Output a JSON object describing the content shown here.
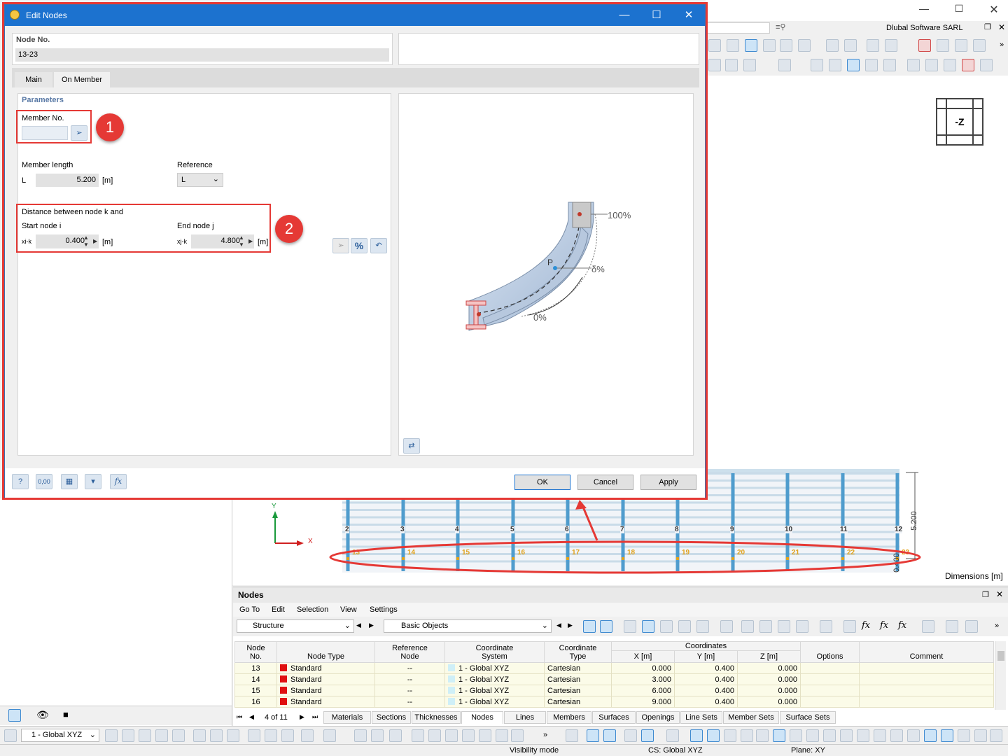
{
  "app": {
    "company": "Dlubal Software SARL",
    "dimensions_label": "Dimensions [m]",
    "view_cube_label": "-Z",
    "axis_x": "X",
    "axis_y": "Y",
    "dim_5200": "5.200",
    "dim_0400": "0.400"
  },
  "dialog": {
    "title": "Edit Nodes",
    "node_no_label": "Node No.",
    "node_no_value": "13-23",
    "tabs": [
      "Main",
      "On Member"
    ],
    "parameters_label": "Parameters",
    "member_no_label": "Member No.",
    "member_no_value": "",
    "member_length_label": "Member length",
    "length_symbol": "L",
    "length_value": "5.200",
    "unit_m": "[m]",
    "reference_label": "Reference",
    "reference_value": "L",
    "distance_label": "Distance between node k and",
    "start_node_label": "Start node i",
    "end_node_label": "End node j",
    "x_ik_symbol": "xi-k",
    "x_ik_value": "0.400",
    "x_jk_symbol": "xj-k",
    "x_jk_value": "4.800",
    "percent_btn": "%",
    "callout_1": "1",
    "callout_2": "2",
    "diagram": {
      "top": "100%",
      "mid": "δ%",
      "bottom": "0%",
      "point": "P"
    },
    "ok": "OK",
    "cancel": "Cancel",
    "apply": "Apply",
    "fx": "fx",
    "zero_icon": "0,00"
  },
  "structure": {
    "member_numbers": [
      "2",
      "3",
      "4",
      "5",
      "6",
      "7",
      "8",
      "9",
      "10",
      "11",
      "12"
    ],
    "node_numbers": [
      "13",
      "14",
      "15",
      "16",
      "17",
      "18",
      "19",
      "20",
      "21",
      "22",
      "23"
    ]
  },
  "nodes_panel": {
    "title": "Nodes",
    "menu": [
      "Go To",
      "Edit",
      "Selection",
      "View",
      "Settings"
    ],
    "structure_combo": "Structure",
    "objects_combo": "Basic Objects",
    "headers": {
      "node_no": [
        "Node",
        "No."
      ],
      "node_type": "Node Type",
      "ref_node": [
        "Reference",
        "Node"
      ],
      "coord_sys": [
        "Coordinate",
        "System"
      ],
      "coord_type": [
        "Coordinate",
        "Type"
      ],
      "coordinates": "Coordinates",
      "x": "X [m]",
      "y": "Y [m]",
      "z": "Z [m]",
      "options": "Options",
      "comment": "Comment"
    },
    "rows": [
      {
        "no": "13",
        "type": "Standard",
        "ref": "--",
        "sys": "1 - Global XYZ",
        "ctype": "Cartesian",
        "x": "0.000",
        "y": "0.400",
        "z": "0.000"
      },
      {
        "no": "14",
        "type": "Standard",
        "ref": "--",
        "sys": "1 - Global XYZ",
        "ctype": "Cartesian",
        "x": "3.000",
        "y": "0.400",
        "z": "0.000"
      },
      {
        "no": "15",
        "type": "Standard",
        "ref": "--",
        "sys": "1 - Global XYZ",
        "ctype": "Cartesian",
        "x": "6.000",
        "y": "0.400",
        "z": "0.000"
      },
      {
        "no": "16",
        "type": "Standard",
        "ref": "--",
        "sys": "1 - Global XYZ",
        "ctype": "Cartesian",
        "x": "9.000",
        "y": "0.400",
        "z": "0.000"
      }
    ],
    "pager": "4 of 11",
    "tabs": [
      "Materials",
      "Sections",
      "Thicknesses",
      "Nodes",
      "Lines",
      "Members",
      "Surfaces",
      "Openings",
      "Line Sets",
      "Member Sets",
      "Surface Sets"
    ],
    "active_tab": "Nodes"
  },
  "bottom_toolbar": {
    "cs_combo": "1 - Global XYZ"
  },
  "status": {
    "visibility": "Visibility mode",
    "cs": "CS: Global XYZ",
    "plane": "Plane: XY"
  }
}
